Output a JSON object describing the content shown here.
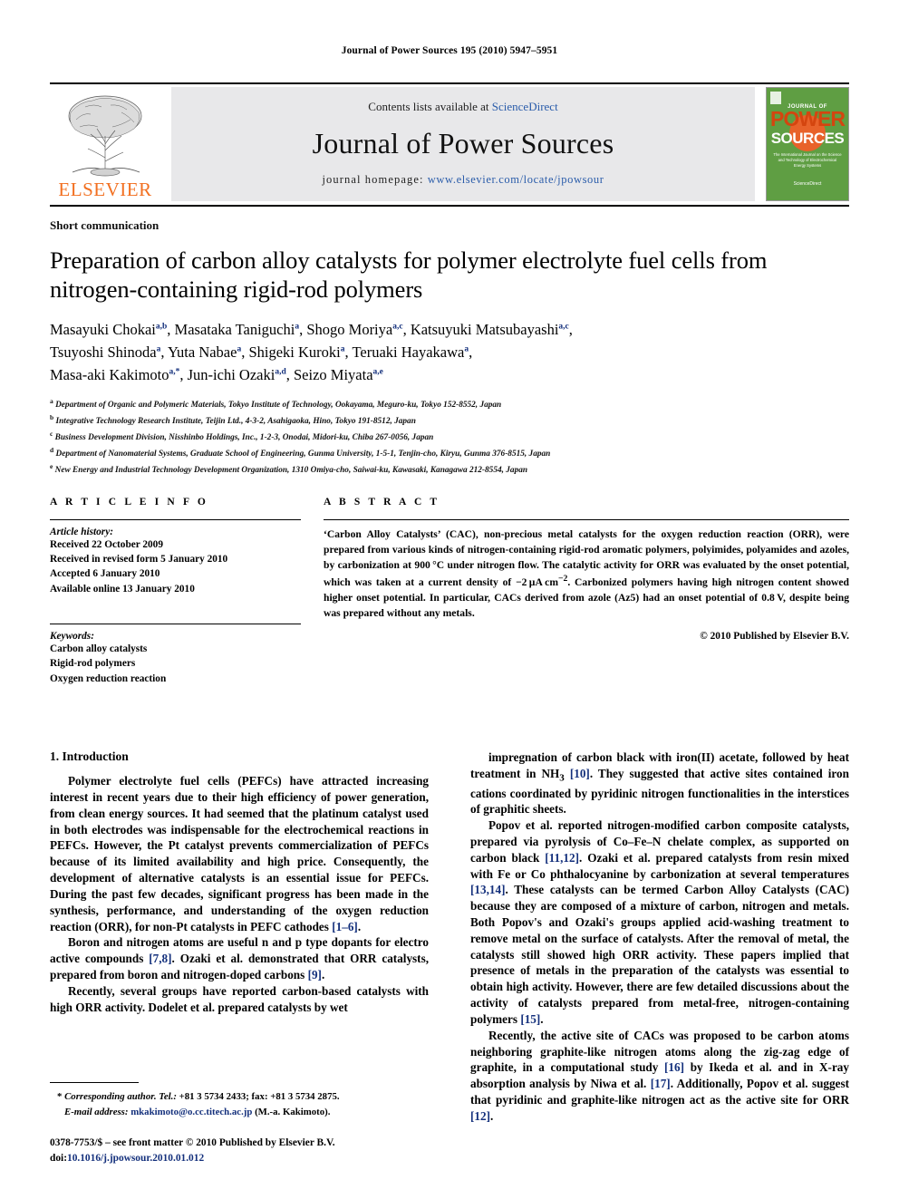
{
  "running_head": "Journal of Power Sources 195 (2010) 5947–5951",
  "masthead": {
    "publisher": "ELSEVIER",
    "contents_prefix": "Contents lists available at ",
    "contents_link": "ScienceDirect",
    "journal_title": "Journal of Power Sources",
    "homepage_prefix": "journal homepage:",
    "homepage_url": "www.elsevier.com/locate/jpowsour",
    "cover": {
      "line1": "JOURNAL OF",
      "line2": "POWER",
      "line3": "SOURCES",
      "subtitle": "The International Journal on the Science and Technology of Electrochemical Energy Systems",
      "sciencedirect": "ScienceDirect"
    }
  },
  "article": {
    "type": "Short communication",
    "title": "Preparation of carbon alloy catalysts for polymer electrolyte fuel cells from nitrogen-containing rigid-rod polymers",
    "authors_html": "Masayuki Chokai<sup class=\"aff\">a,b</sup>, Masataka Taniguchi<sup class=\"aff\">a</sup>, Shogo Moriya<sup class=\"aff\">a,c</sup>, Katsuyuki Matsubayashi<sup class=\"aff\">a,c</sup>,<br>Tsuyoshi Shinoda<sup class=\"aff\">a</sup>, Yuta Nabae<sup class=\"aff\">a</sup>, Shigeki Kuroki<sup class=\"aff\">a</sup>, Teruaki Hayakawa<sup class=\"aff\">a</sup>,<br>Masa-aki Kakimoto<sup class=\"aff\">a,*</sup>, Jun-ichi Ozaki<sup class=\"aff\">a,d</sup>, Seizo Miyata<sup class=\"aff\">a,e</sup>",
    "affiliations": [
      {
        "marker": "a",
        "text": "Department of Organic and Polymeric Materials, Tokyo Institute of Technology, Ookayama, Meguro-ku, Tokyo 152-8552, Japan"
      },
      {
        "marker": "b",
        "text": "Integrative Technology Research Institute, Teijin Ltd., 4-3-2, Asahigaoka, Hino, Tokyo 191-8512, Japan"
      },
      {
        "marker": "c",
        "text": "Business Development Division, Nisshinbo Holdings, Inc., 1-2-3, Onodai, Midori-ku, Chiba 267-0056, Japan"
      },
      {
        "marker": "d",
        "text": "Department of Nanomaterial Systems, Graduate School of Engineering, Gunma University, 1-5-1, Tenjin-cho, Kiryu, Gunma 376-8515, Japan"
      },
      {
        "marker": "e",
        "text": "New Energy and Industrial Technology Development Organization, 1310 Omiya-cho, Saiwai-ku, Kawasaki, Kanagawa 212-8554, Japan"
      }
    ]
  },
  "article_info": {
    "heading": "A R T I C L E   I N F O",
    "history_label": "Article history:",
    "history": [
      "Received 22 October 2009",
      "Received in revised form 5 January 2010",
      "Accepted 6 January 2010",
      "Available online 13 January 2010"
    ],
    "keywords_label": "Keywords:",
    "keywords": [
      "Carbon alloy catalysts",
      "Rigid-rod polymers",
      "Oxygen reduction reaction"
    ]
  },
  "abstract": {
    "heading": "A B S T R A C T",
    "text_html": "‘Carbon Alloy Catalysts’ (CAC), non-precious metal catalysts for the oxygen reduction reaction (ORR), were prepared from various kinds of nitrogen-containing rigid-rod aromatic polymers, polyimides, polyamides and azoles, by carbonization at 900&#8201;°C under nitrogen flow. The catalytic activity for ORR was evaluated by the onset potential, which was taken at a current density of &minus;2&#8201;&micro;A&#8201;cm<sup>&minus;2</sup>. Carbonized polymers having high nitrogen content showed higher onset potential. In particular, CACs derived from azole (Az5) had an onset potential of 0.8&#8201;V, despite being was prepared without any metals.",
    "copyright": "© 2010 Published by Elsevier B.V."
  },
  "body": {
    "section_number_title": "1.  Introduction",
    "left_paragraphs_html": [
      "Polymer electrolyte fuel cells (PEFCs) have attracted increasing interest in recent years due to their high efficiency of power generation, from clean energy sources. It had seemed that the platinum catalyst used in both electrodes was indispensable for the electrochemical reactions in PEFCs. However, the Pt catalyst prevents commercialization of PEFCs because of its limited availability and high price. Consequently, the development of alternative catalysts is an essential issue for PEFCs. During the past few decades, significant progress has been made in the synthesis, performance, and understanding of the oxygen reduction reaction (ORR), for non-Pt catalysts in PEFC cathodes <span class=\"ref\">[1–6]</span>.",
      "Boron and nitrogen atoms are useful n and p type dopants for electro active compounds <span class=\"ref\">[7,8]</span>. Ozaki et al. demonstrated that ORR catalysts, prepared from boron and nitrogen-doped carbons <span class=\"ref\">[9]</span>.",
      "Recently, several groups have reported carbon-based catalysts with high ORR activity. Dodelet et al. prepared catalysts by wet"
    ],
    "right_paragraphs_html": [
      "impregnation of carbon black with iron(II) acetate, followed by heat treatment in NH<sub>3</sub> <span class=\"ref\">[10]</span>. They suggested that active sites contained iron cations coordinated by pyridinic nitrogen functionalities in the interstices of graphitic sheets.",
      "Popov et al. reported nitrogen-modified carbon composite catalysts, prepared via pyrolysis of Co–Fe–N chelate complex, as supported on carbon black <span class=\"ref\">[11,12]</span>. Ozaki et al. prepared catalysts from resin mixed with Fe or Co phthalocyanine by carbonization at several temperatures <span class=\"ref\">[13,14]</span>. These catalysts can be termed Carbon Alloy Catalysts (CAC) because they are composed of a mixture of carbon, nitrogen and metals. Both Popov's and Ozaki's groups applied acid-washing treatment to remove metal on the surface of catalysts. After the removal of metal, the catalysts still showed high ORR activity. These papers implied that presence of metals in the preparation of the catalysts was essential to obtain high activity. However, there are few detailed discussions about the activity of catalysts prepared from metal-free, nitrogen-containing polymers <span class=\"ref\">[15]</span>.",
      "Recently, the active site of CACs was proposed to be carbon atoms neighboring graphite-like nitrogen atoms along the zig-zag edge of graphite, in a computational study <span class=\"ref\">[16]</span> by Ikeda et al. and in X-ray absorption analysis by Niwa et al. <span class=\"ref\">[17]</span>. Additionally, Popov et al. suggest that pyridinic and graphite-like nitrogen act as the active site for ORR <span class=\"ref\">[12]</span>."
    ]
  },
  "footnote": {
    "corresponding_html": "<b>*</b> <span class=\"em\">Corresponding author. Tel.:</span> +81 3 5734 2433; fax: +81 3 5734 2875.",
    "email_html": "<span class=\"em\">E-mail address:</span> <span class=\"fn-mail\">mkakimoto@o.cc.titech.ac.jp</span> (M.-a. Kakimoto).",
    "issn_line": "0378-7753/$ – see front matter © 2010 Published by Elsevier B.V.",
    "doi_prefix": "doi:",
    "doi_value": "10.1016/j.jpowsour.2010.01.012"
  },
  "colors": {
    "link": "#2a5caa",
    "reference": "#14307c",
    "elsevier_orange": "#F27021",
    "cover_green": "#5f9e43",
    "band_grey": "#e8e8ea"
  }
}
